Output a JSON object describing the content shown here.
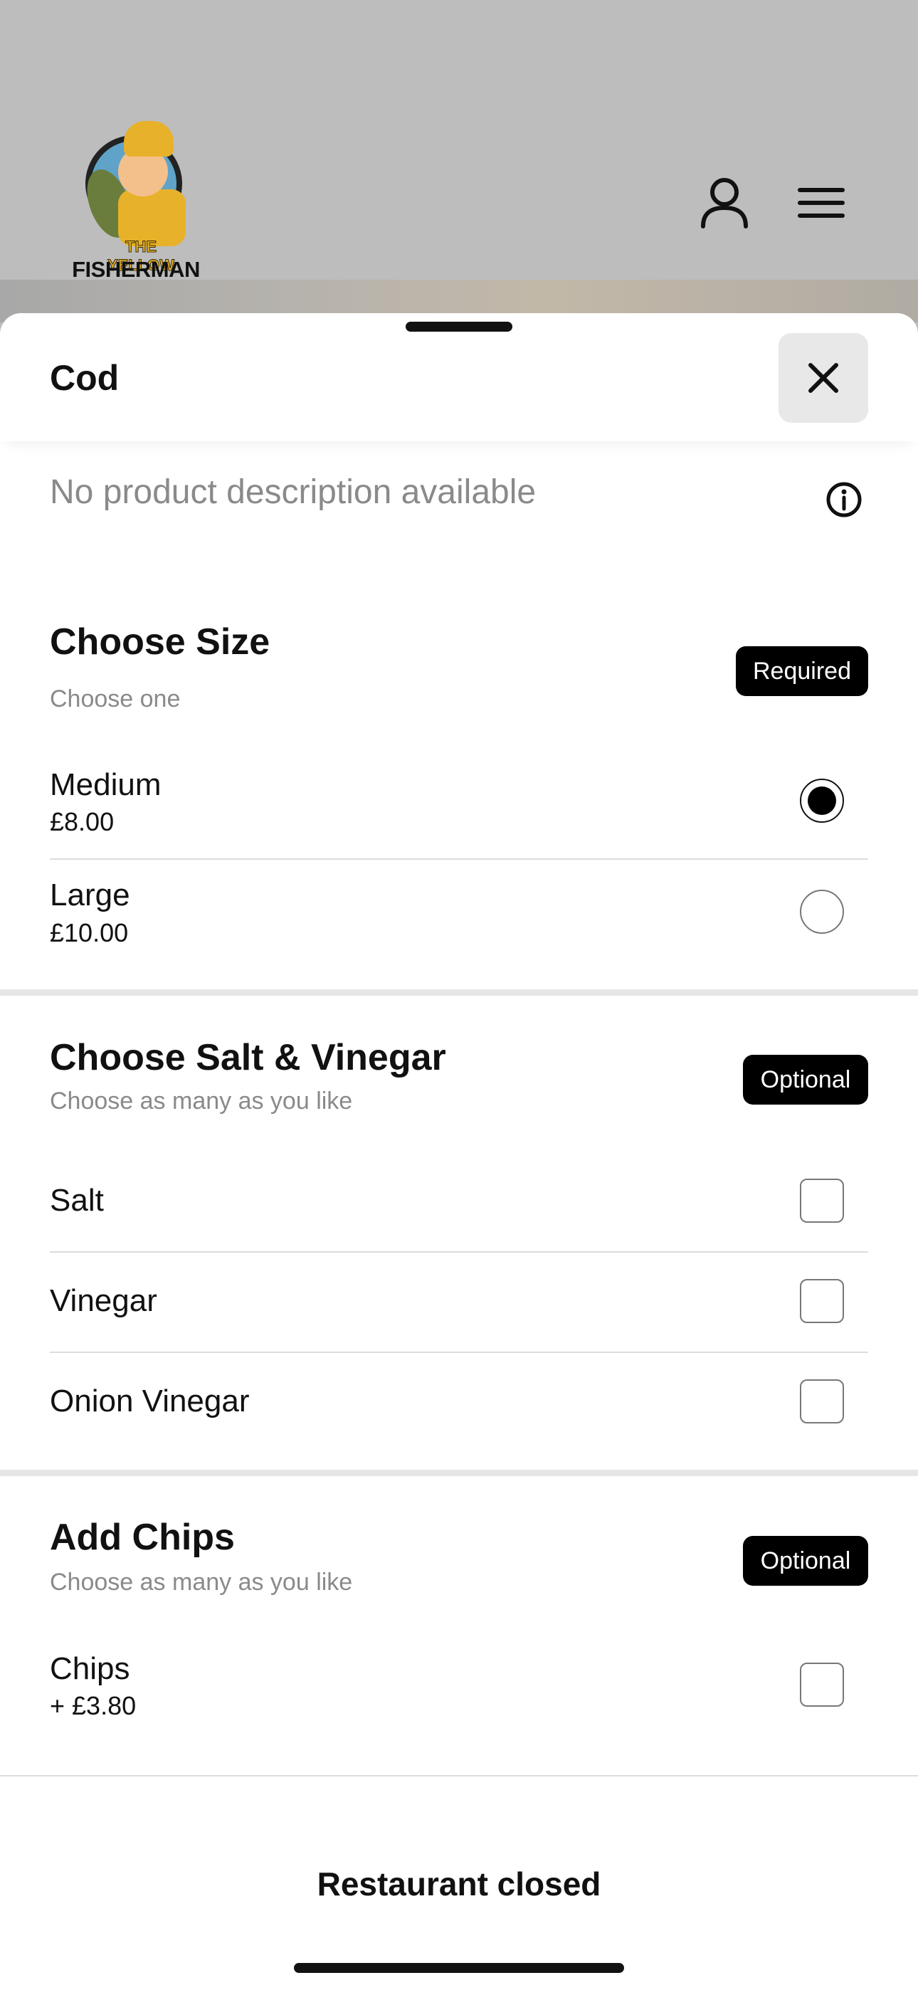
{
  "header": {
    "logo": {
      "line1": "THE YELLOW",
      "line2": "FISHERMAN"
    },
    "icons": {
      "account": "user-icon",
      "menu": "hamburger-menu-icon"
    }
  },
  "product": {
    "title": "Cod",
    "description": "No product description available",
    "close_icon": "close-icon",
    "info_icon": "info-icon"
  },
  "sections": [
    {
      "title": "Choose Size",
      "subtitle": "Choose one",
      "badge": "Required",
      "options": [
        {
          "name": "Medium",
          "price": "£8.00",
          "selected": true
        },
        {
          "name": "Large",
          "price": "£10.00",
          "selected": false
        }
      ]
    },
    {
      "title": "Choose Salt & Vinegar",
      "subtitle": "Choose as many as you like",
      "badge": "Optional",
      "options": [
        {
          "name": "Salt",
          "checked": false
        },
        {
          "name": "Vinegar",
          "checked": false
        },
        {
          "name": "Onion Vinegar",
          "checked": false
        }
      ]
    },
    {
      "title": "Add Chips",
      "subtitle": "Choose as many as you like",
      "badge": "Optional",
      "options": [
        {
          "name": "Chips",
          "price": "+ £3.80",
          "checked": false
        }
      ]
    }
  ],
  "footer": {
    "status": "Restaurant closed"
  },
  "colors": {
    "badge_bg": "#000000",
    "sheet_bg": "#ffffff",
    "backdrop": "#bdbdbd"
  }
}
